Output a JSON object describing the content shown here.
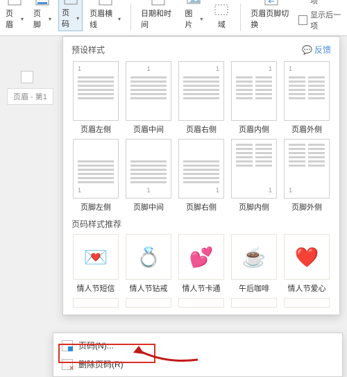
{
  "ribbon": {
    "header_btn": "页眉",
    "footer_btn": "页脚",
    "page_number_btn": "页码",
    "crossline_btn": "页眉横线",
    "datetime_btn": "日期和时间",
    "picture_btn": "图片",
    "field_btn": "域",
    "switch_btn": "页眉页脚切换",
    "show_prev": "显示前一项",
    "show_next": "显示后一项"
  },
  "doc": {
    "header_field": "页眉 - 第1"
  },
  "panel": {
    "preset_title": "预设样式",
    "feedback": "反馈",
    "styles_row1": [
      "页眉左侧",
      "页眉中间",
      "页眉右侧",
      "页眉内侧",
      "页眉外侧"
    ],
    "styles_row2": [
      "页脚左侧",
      "页脚中间",
      "页脚右侧",
      "页脚内侧",
      "页脚外侧"
    ],
    "promo_title": "页码样式推荐",
    "promos": [
      {
        "icon": "💌",
        "label": "情人节短信"
      },
      {
        "icon": "💍",
        "label": "情人节钻戒"
      },
      {
        "icon": "💕",
        "label": "情人节卡通"
      },
      {
        "icon": "☕",
        "label": "午后咖啡"
      },
      {
        "icon": "❤️",
        "label": "情人节爱心"
      }
    ]
  },
  "menu": {
    "page_number": "页码(N)...",
    "delete_page_number": "删除页码(R)"
  }
}
